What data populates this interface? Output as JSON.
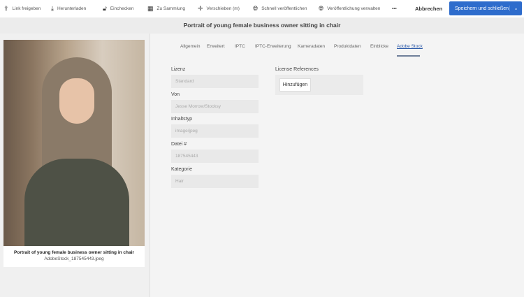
{
  "toolbar": {
    "items": [
      {
        "label": "Link freigeben",
        "icon": "share-icon"
      },
      {
        "label": "Herunterladen",
        "icon": "download-icon"
      },
      {
        "label": "Einchecken",
        "icon": "unlock-icon"
      },
      {
        "label": "Zu Sammlung",
        "icon": "collection-icon"
      },
      {
        "label": "Verschieben (m)",
        "icon": "move-icon"
      },
      {
        "label": "Schnell veröffentlichen",
        "icon": "globe-icon"
      },
      {
        "label": "Veröffentlichung verwalten",
        "icon": "globe-gear-icon"
      }
    ],
    "more": "•••",
    "cancel": "Abbrechen",
    "save": "Speichern und schließen",
    "save_chevron": "⌄"
  },
  "title": "Portrait of young female business owner sitting in chair",
  "asset": {
    "title": "Portrait of young female business owner sitting in chair",
    "filename": "AdobeStock_187545443.jpeg"
  },
  "tabs": [
    "Allgemein",
    "Erweitert",
    "IPTC",
    "IPTC-Erweiterung",
    "Kameradaten",
    "Produktdaten",
    "Einblicke",
    "Adobe Stock"
  ],
  "active_tab": "Adobe Stock",
  "fields": [
    {
      "label": "Lizenz",
      "value": "Standard"
    },
    {
      "label": "Von",
      "value": "Jesse Morrow/Stocksy"
    },
    {
      "label": "Inhaltstyp",
      "value": "image/jpeg"
    },
    {
      "label": "Datei #",
      "value": "187545443"
    },
    {
      "label": "Kategorie",
      "value": "Hair"
    }
  ],
  "license_references": {
    "label": "License References",
    "add": "Hinzufügen"
  }
}
